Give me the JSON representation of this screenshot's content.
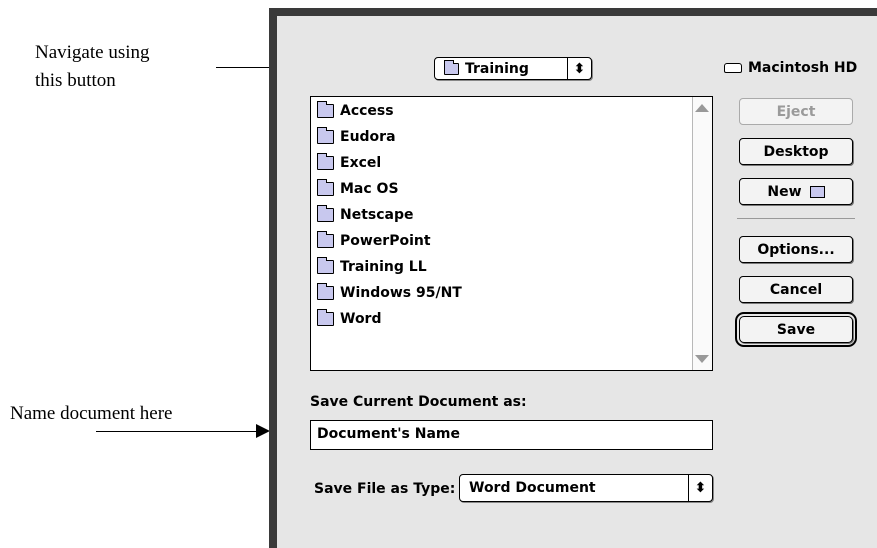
{
  "annotations": {
    "navigate_line1": "Navigate using",
    "navigate_line2": "this button",
    "name_doc": "Name document here"
  },
  "dialog": {
    "location_popup": {
      "label": "Training",
      "icon": "folder-icon",
      "arrows": "⬍"
    },
    "disk_label": "Macintosh HD",
    "files": [
      "Access",
      "Eudora",
      "Excel",
      "Mac OS",
      "Netscape",
      "PowerPoint",
      "Training LL",
      "Windows 95/NT",
      "Word"
    ],
    "buttons": {
      "eject": "Eject",
      "desktop": "Desktop",
      "new": "New",
      "options": "Options...",
      "cancel": "Cancel",
      "save": "Save"
    },
    "save_as_label": "Save Current Document as:",
    "document_name": "Document's Name",
    "file_type_label": "Save File as Type:",
    "file_type_value": "Word Document",
    "file_type_arrows": "⬍"
  },
  "colors": {
    "folder": "#c8c8ee",
    "dialog_bg": "#e6e6e6",
    "frame": "#3a3a3a"
  }
}
